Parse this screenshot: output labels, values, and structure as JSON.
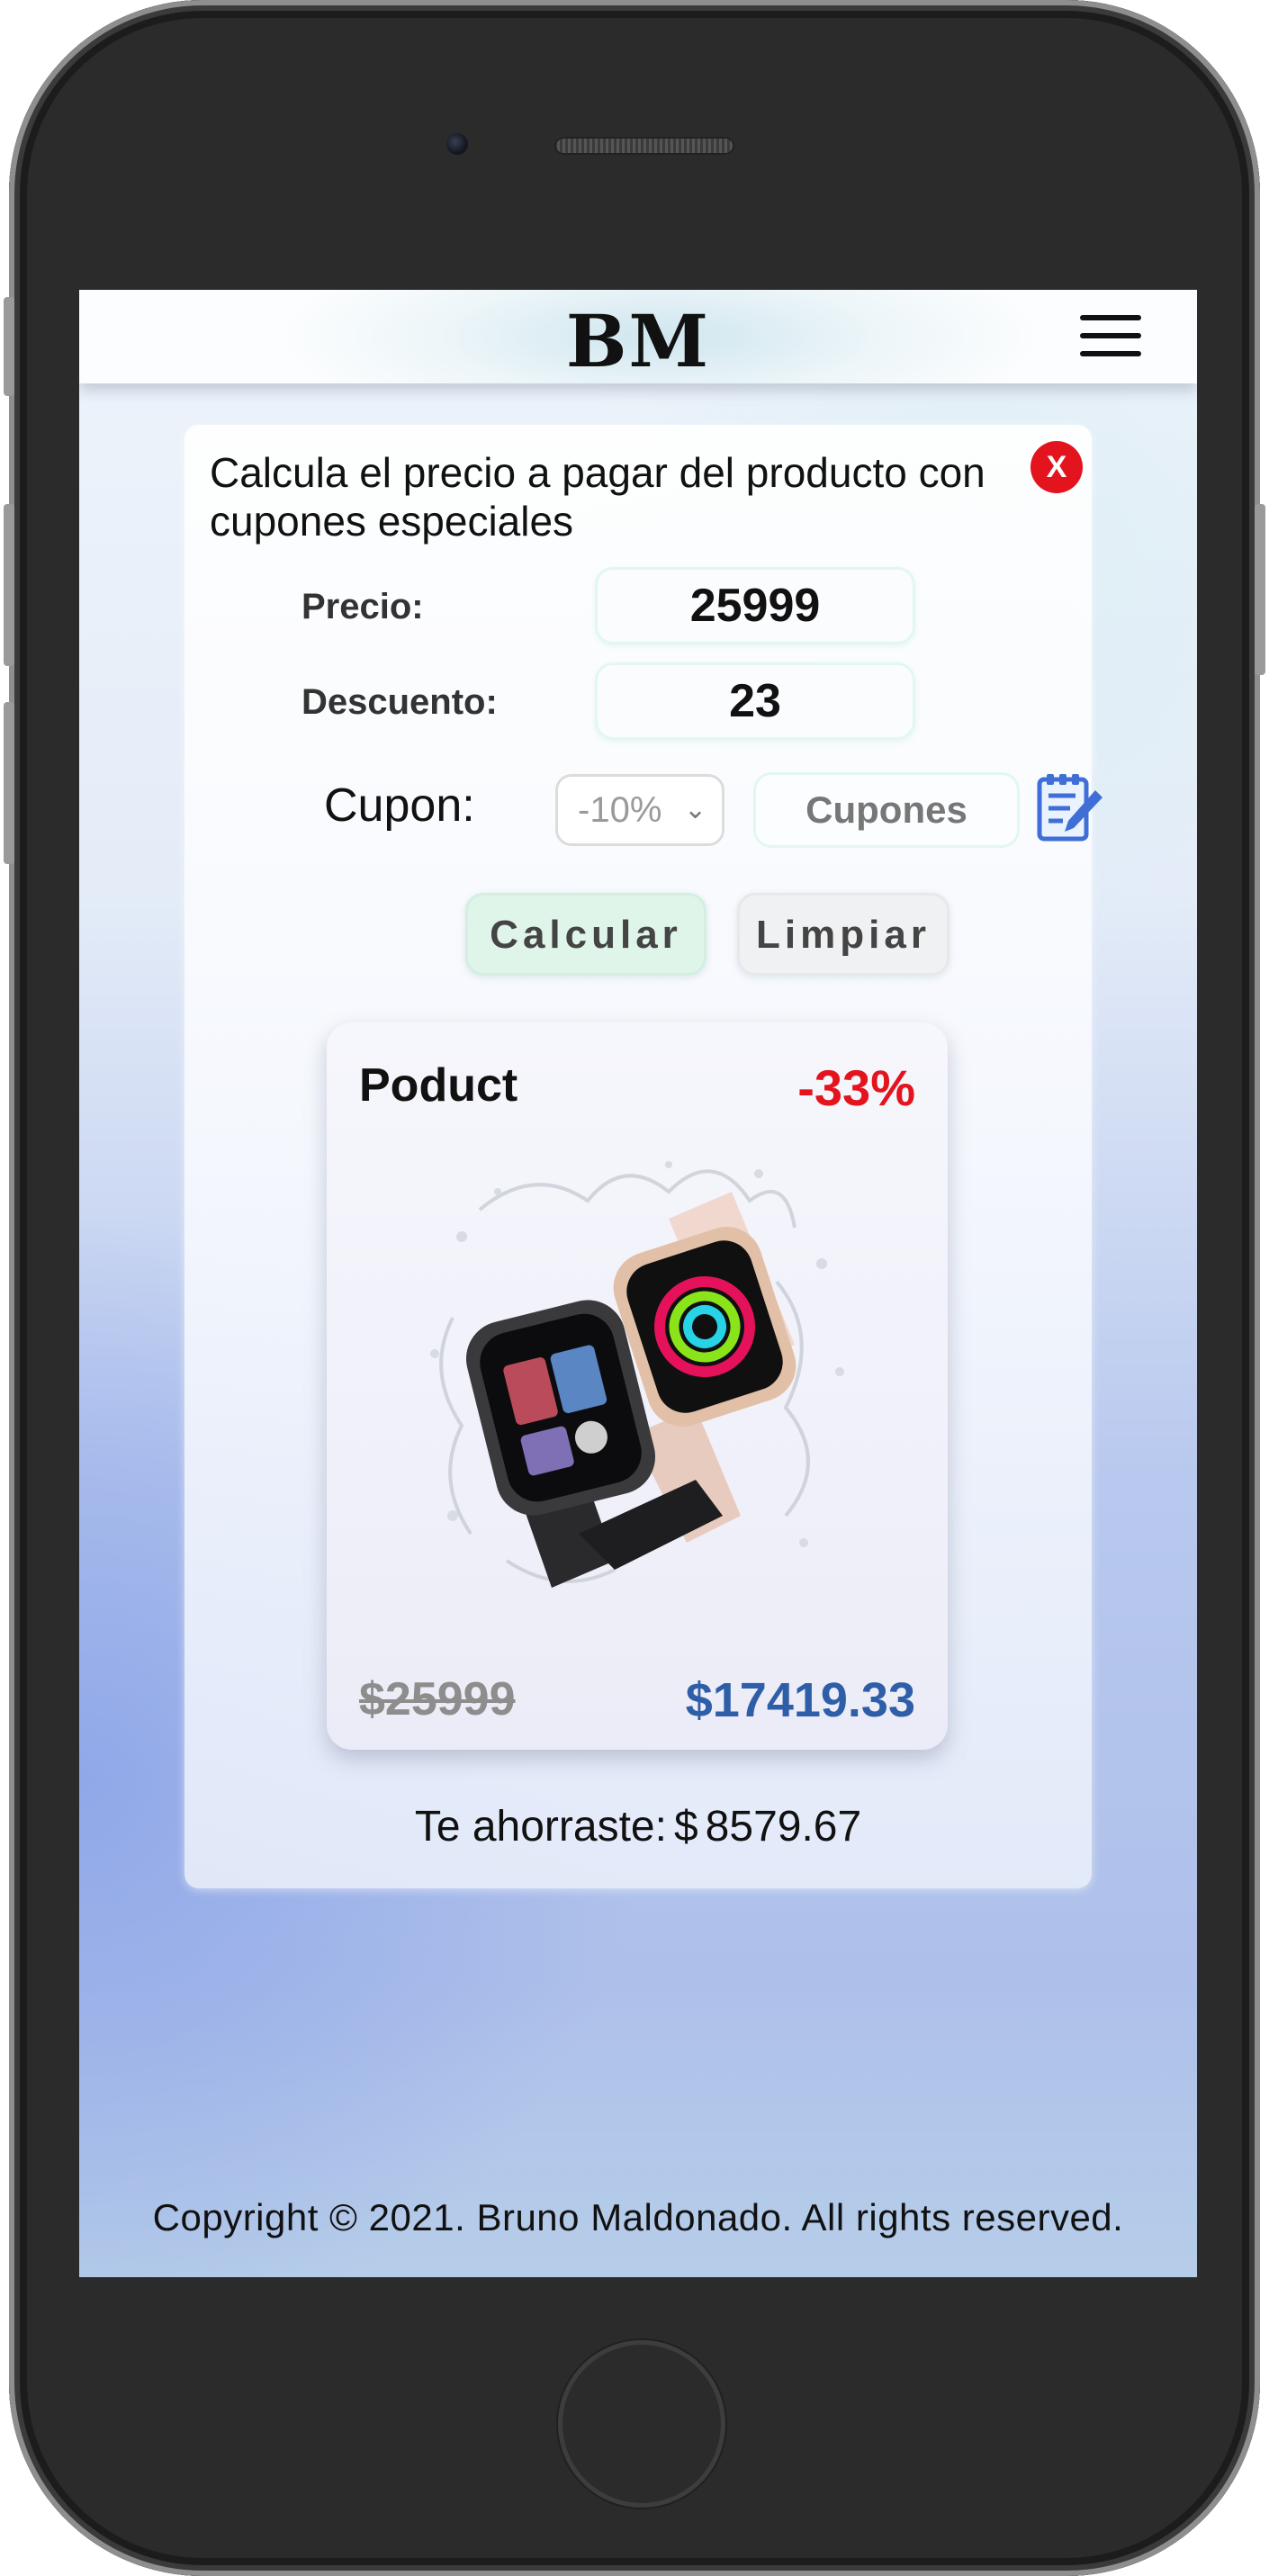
{
  "app": {
    "logo": "BM",
    "menu_icon": "hamburger-menu-icon"
  },
  "panel": {
    "title": "Calcula el precio a pagar del producto con cupones especiales",
    "close_label": "X",
    "price_label": "Precio:",
    "price_value": "25999",
    "discount_label": "Descuento:",
    "discount_value": "23",
    "coupon_label": "Cupon:",
    "coupon_selected": "-10%",
    "coupons_button": "Cupones",
    "edit_icon": "edit-note-icon",
    "calculate_button": "Calcular",
    "clear_button": "Limpiar",
    "savings_label": "Te ahorraste:",
    "savings_currency": "$",
    "savings_value": "8579.67"
  },
  "card": {
    "title": "Poduct",
    "discount_badge": "-33%",
    "image": "smartwatch-product-image",
    "original_price": "$25999",
    "final_price": "$17419.33"
  },
  "footer": {
    "copyright": "Copyright © 2021. Bruno Maldonado. All rights reserved."
  },
  "colors": {
    "accent_red": "#e3141d",
    "price_blue": "#2e5ea8"
  }
}
